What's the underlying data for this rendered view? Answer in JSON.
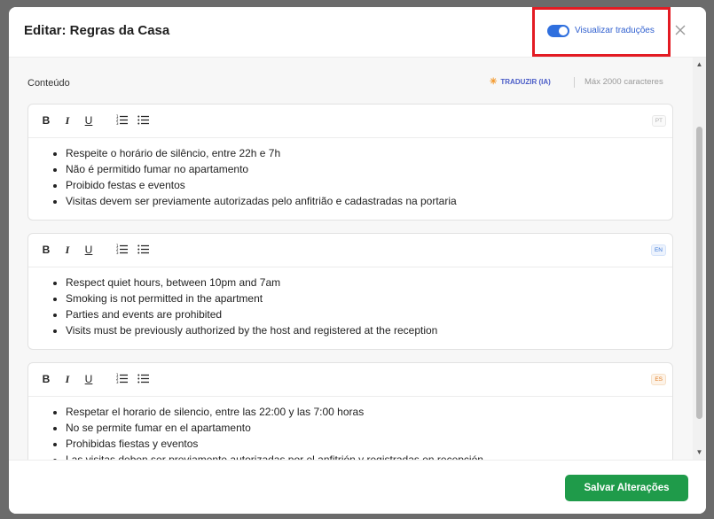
{
  "header": {
    "title": "Editar: Regras da Casa",
    "toggle_label": "Visualizar traduções",
    "toggle_on": true
  },
  "content": {
    "section_label": "Conteúdo",
    "translate_label": "TRADUZIR (IA)",
    "max_chars": "Máx 2000 caracteres"
  },
  "toolbar": {
    "bold": "B",
    "italic": "I",
    "underline": "U"
  },
  "editors": [
    {
      "lang": "PT",
      "items": [
        "Respeite o horário de silêncio, entre 22h e 7h",
        "Não é permitido fumar no apartamento",
        "Proibido festas e eventos",
        "Visitas devem ser previamente autorizadas pelo anfitrião e cadastradas na portaria"
      ]
    },
    {
      "lang": "EN",
      "items": [
        "Respect quiet hours, between 10pm and 7am",
        "Smoking is not permitted in the apartment",
        "Parties and events are prohibited",
        "Visits must be previously authorized by the host and registered at the reception"
      ]
    },
    {
      "lang": "ES",
      "items": [
        "Respetar el horario de silencio, entre las 22:00 y las 7:00 horas",
        "No se permite fumar en el apartamento",
        "Prohibidas fiestas y eventos",
        "Las visitas deben ser previamente autorizadas por el anfitrión y registradas en recepción"
      ]
    }
  ],
  "footer": {
    "save_label": "Salvar Alterações"
  },
  "colors": {
    "accent": "#2f6fde",
    "save": "#1f9b4a",
    "highlight": "#e31b23"
  }
}
